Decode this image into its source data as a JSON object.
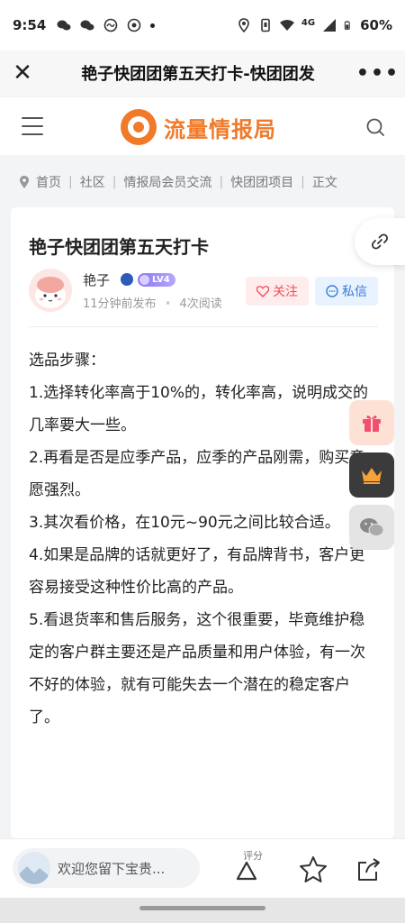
{
  "status_bar": {
    "time": "9:54",
    "network": "4G",
    "battery": "60%"
  },
  "title_bar": {
    "title": "艳子快团团第五天打卡-快团团发",
    "more": "•••"
  },
  "header": {
    "logo_text": "流量情报局",
    "accent": "#f07a2a"
  },
  "breadcrumb": {
    "items": [
      "首页",
      "社区",
      "情报局会员交流",
      "快团团项目",
      "正文"
    ],
    "separator": "|"
  },
  "post": {
    "title": "艳子快团团第五天打卡",
    "author": "艳子",
    "level": "LV4",
    "time": "11分钟前发布",
    "meta_dot": "•",
    "views": "4次阅读",
    "follow_label": "关注",
    "message_label": "私信",
    "paragraphs": [
      "选品步骤：",
      "1.选择转化率高于10%的，转化率高，说明成交的几率要大一些。",
      "2.再看是否是应季产品，应季的产品刚需，购买意愿强烈。",
      "3.其次看价格，在10元~90元之间比较合适。",
      "4.如果是品牌的话就更好了，有品牌背书，客户更容易接受这种性价比高的产品。",
      "5.看退货率和售后服务，这个很重要，毕竟维护稳定的客户群主要还是产品质量和用户体验，有一次不好的体验，就有可能失去一个潜在的稳定客户了。"
    ]
  },
  "bottom_bar": {
    "comment_placeholder": "欢迎您留下宝贵...",
    "rating_label": "评分"
  },
  "colors": {
    "follow": "#ef4f5a",
    "message": "#3a7bd5",
    "level_badge": "#8a76f3"
  }
}
